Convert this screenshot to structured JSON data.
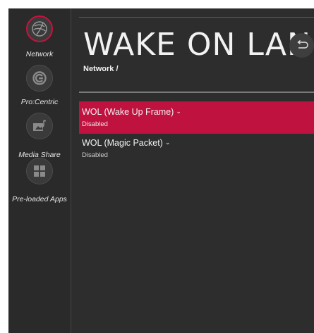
{
  "sidebar": {
    "items": [
      {
        "label": "Network",
        "icon": "network-globe-icon",
        "active": true
      },
      {
        "label": "Pro:Centric",
        "icon": "procentric-icon",
        "active": false
      },
      {
        "label": "Media Share",
        "icon": "media-share-icon",
        "active": false
      },
      {
        "label": "Pre-loaded Apps",
        "icon": "apps-grid-icon",
        "active": false
      }
    ]
  },
  "header": {
    "title": "WAKE ON LAN",
    "breadcrumb": "Network /"
  },
  "list": {
    "items": [
      {
        "label": "WOL (Wake Up Frame)",
        "value": "Disabled",
        "selected": true
      },
      {
        "label": "WOL (Magic Packet)",
        "value": "Disabled",
        "selected": false
      }
    ]
  },
  "colors": {
    "accent": "#c0123f",
    "background": "#2d2d2d",
    "text": "#f2f2f2"
  }
}
